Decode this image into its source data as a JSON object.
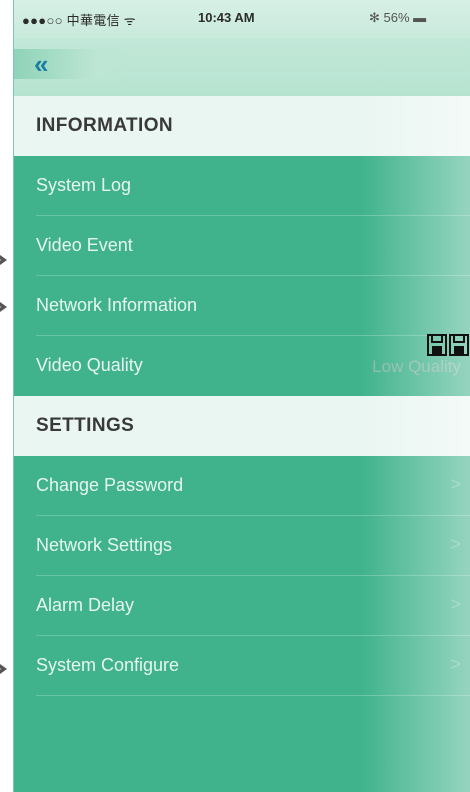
{
  "status_bar": {
    "carrier": "●●●○○ 中華電信 ᯤ",
    "time": "10:43 AM",
    "battery": "✻ 56% ▬"
  },
  "nav": {
    "back_label": "«"
  },
  "sections": [
    {
      "title": "INFORMATION",
      "rows": [
        {
          "label": "System Log"
        },
        {
          "label": "Video Event"
        },
        {
          "label": "Network Information"
        },
        {
          "label": "Video Quality",
          "value": "Low Quality"
        }
      ]
    },
    {
      "title": "SETTINGS",
      "rows": [
        {
          "label": "Change Password",
          "chevron": ">"
        },
        {
          "label": "Network Settings",
          "chevron": ">"
        },
        {
          "label": "Alarm Delay",
          "chevron": ">"
        },
        {
          "label": "System Configure",
          "chevron": ">"
        }
      ]
    }
  ],
  "icons": {
    "save": "floppy-disk-icon",
    "pointer": "arrow-pointer-icon"
  },
  "colors": {
    "accent": "#40b38c",
    "header_bg": "#eaf6f1",
    "back_chevron": "#1a7ea0"
  }
}
